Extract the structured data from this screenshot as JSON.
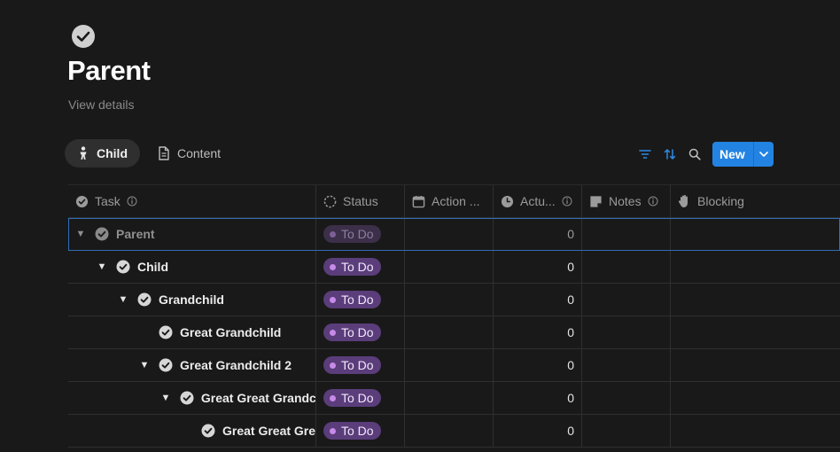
{
  "page": {
    "icon": "check-circle-icon",
    "title": "Parent",
    "view_details": "View details"
  },
  "tabs": [
    {
      "label": "Child",
      "icon": "person-icon",
      "active": true
    },
    {
      "label": "Content",
      "icon": "document-icon",
      "active": false
    }
  ],
  "toolbar": {
    "filter_icon": "filter-icon",
    "sort_icon": "sort-icon",
    "search_icon": "search-icon",
    "new_label": "New",
    "accent_color": "#2383e2"
  },
  "columns": [
    {
      "label": "Task",
      "icon": "check-circle-icon",
      "info": true
    },
    {
      "label": "Status",
      "icon": "status-icon",
      "info": false
    },
    {
      "label": "Action ...",
      "icon": "calendar-icon",
      "info": false
    },
    {
      "label": "Actu...",
      "icon": "clock-icon",
      "info": true
    },
    {
      "label": "Notes",
      "icon": "note-icon",
      "info": true
    },
    {
      "label": "Blocking",
      "icon": "hand-icon",
      "info": false
    }
  ],
  "rows": [
    {
      "name": "Parent",
      "toggle": "▼",
      "status": "To Do",
      "actual": "0"
    },
    {
      "name": "Child",
      "toggle": "▼",
      "status": "To Do",
      "actual": "0"
    },
    {
      "name": "Grandchild",
      "toggle": "▼",
      "status": "To Do",
      "actual": "0"
    },
    {
      "name": "Great Grandchild",
      "toggle": "",
      "status": "To Do",
      "actual": "0"
    },
    {
      "name": "Great Grandchild 2",
      "toggle": "▼",
      "status": "To Do",
      "actual": "0"
    },
    {
      "name": "Great Great Grandc",
      "toggle": "▼",
      "status": "To Do",
      "actual": "0"
    },
    {
      "name": "Great Great Gre",
      "toggle": "",
      "status": "To Do",
      "actual": "0"
    }
  ],
  "colors": {
    "background": "#191919",
    "status_todo": "#5a3d7a",
    "status_dot": "#c68ae8"
  }
}
